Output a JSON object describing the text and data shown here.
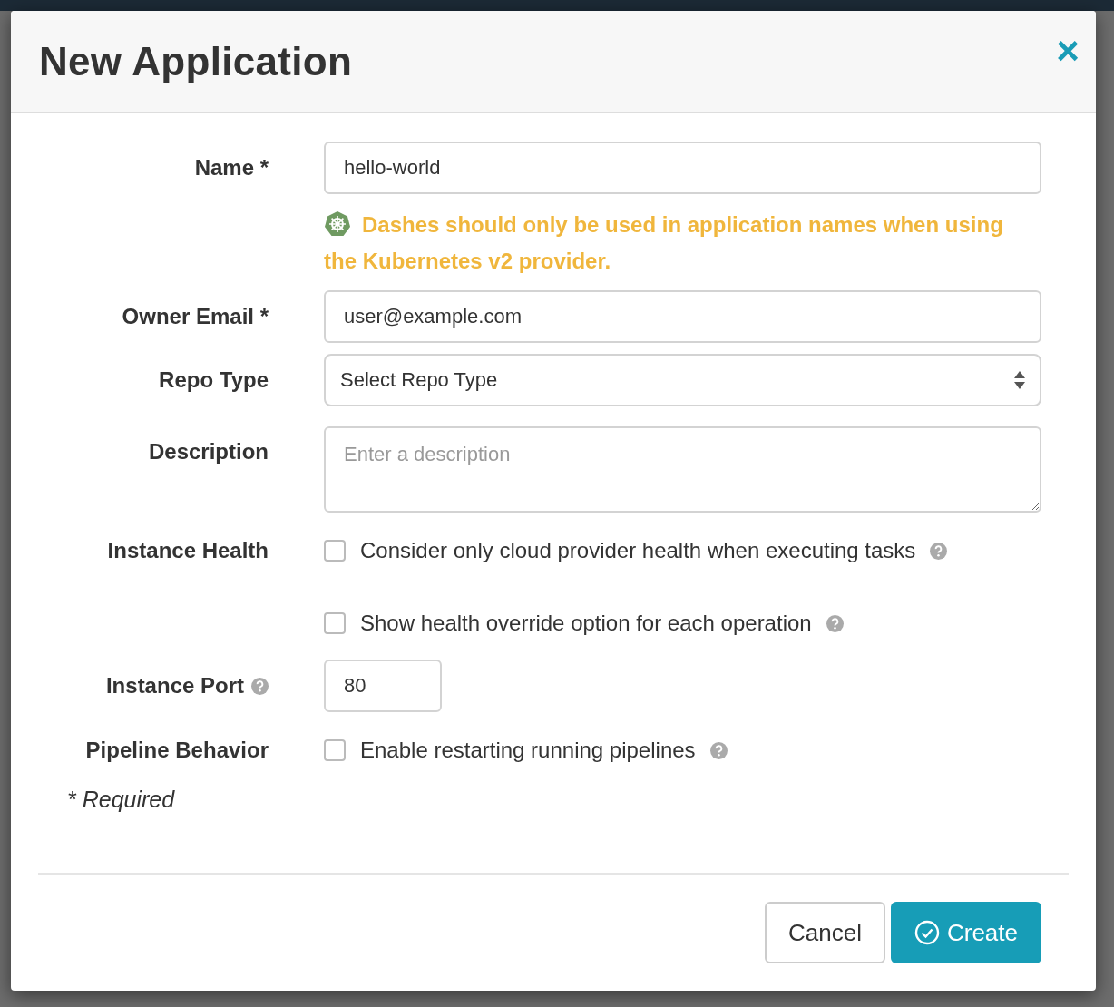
{
  "dialog": {
    "title": "New Application",
    "close": "×"
  },
  "rows": [
    {
      "label": "Name *",
      "kind": "text",
      "value": "hello-world",
      "warning": "Dashes should only be used in application names when using the Kubernetes v2 provider."
    },
    {
      "label": "Owner Email *",
      "kind": "text",
      "value": "user@example.com"
    },
    {
      "label": "Repo Type",
      "kind": "select",
      "value": "Select Repo Type"
    },
    {
      "label": "Description",
      "kind": "textarea",
      "placeholder": "Enter a description"
    },
    {
      "label": "Instance Health",
      "kind": "checkboxes",
      "options": [
        {
          "text": "Consider only cloud provider health when executing tasks",
          "checked": false
        },
        {
          "text": "Show health override option for each operation",
          "checked": false
        }
      ]
    },
    {
      "label": "Instance Port",
      "help": true,
      "kind": "number",
      "value": "80"
    },
    {
      "label": "Pipeline Behavior",
      "kind": "checkboxes",
      "options": [
        {
          "text": "Enable restarting running pipelines",
          "checked": false
        }
      ]
    }
  ],
  "required_note": "* Required",
  "buttons": [
    {
      "label": "Cancel",
      "kind": "secondary"
    },
    {
      "label": "Create",
      "kind": "primary"
    }
  ]
}
